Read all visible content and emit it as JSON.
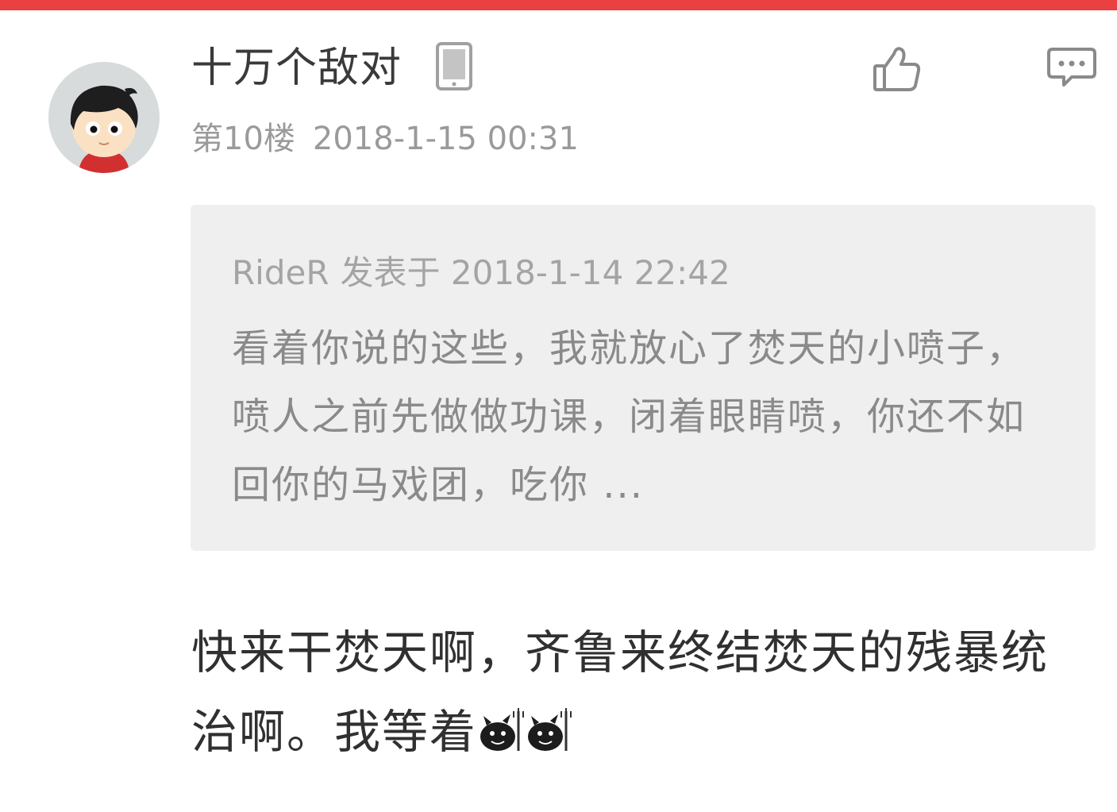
{
  "comment": {
    "username": "十万个敌对",
    "floor": "第10楼",
    "timestamp": "2018-1-15 00:31",
    "device_icon": "phone-icon",
    "actions": {
      "like_icon": "thumbs-up-icon",
      "comment_icon": "comment-bubble-icon"
    },
    "quote": {
      "author": "RideR",
      "posted_label": "发表于",
      "timestamp": "2018-1-14 22:42",
      "text": "看着你说的这些，我就放心了焚天的小喷子，喷人之前先做做功课，闭着眼睛喷，你还不如回你的马戏团，吃你 ..."
    },
    "reply": {
      "text": "快来干焚天啊，齐鲁来终结焚天的残暴统治啊。我等着",
      "emojis": [
        "devil-emoji",
        "devil-emoji"
      ]
    }
  },
  "colors": {
    "accent": "#e94040",
    "quote_background": "#efefef",
    "meta_text": "#9a9a9a"
  }
}
